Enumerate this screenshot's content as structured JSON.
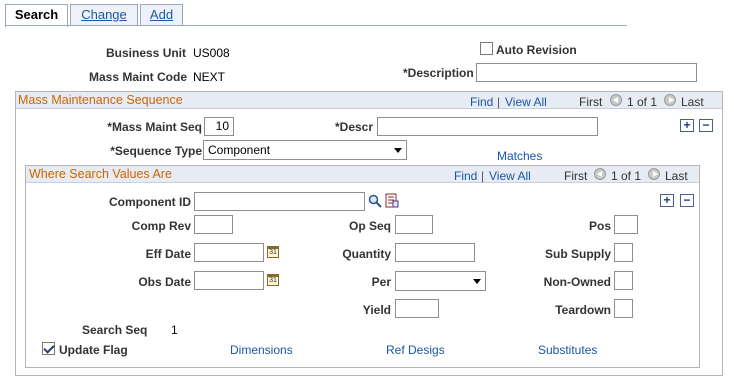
{
  "tabs": [
    {
      "label": "Search",
      "active": true
    },
    {
      "label": "Change",
      "active": false
    },
    {
      "label": "Add",
      "active": false
    }
  ],
  "header": {
    "business_unit_label": "Business Unit",
    "business_unit_value": "US008",
    "mass_maint_code_label": "Mass Maint Code",
    "mass_maint_code_value": "NEXT",
    "auto_revision_label": "Auto Revision",
    "auto_revision_checked": false,
    "description_label": "*Description",
    "description_value": ""
  },
  "sequence_box": {
    "title": "Mass Maintenance Sequence",
    "find": "Find",
    "sep": "|",
    "view_all": "View All",
    "first": "First",
    "counter": "1 of 1",
    "last": "Last",
    "seq_label": "*Mass Maint Seq",
    "seq_value": "10",
    "descr_label": "*Descr",
    "descr_value": "",
    "sequence_type_label": "*Sequence Type",
    "sequence_type_value": "Component",
    "matches_link": "Matches",
    "add_icon": "+",
    "remove_icon": "−"
  },
  "where_box": {
    "title": "Where Search Values Are",
    "find": "Find",
    "sep": "|",
    "view_all": "View All",
    "first": "First",
    "counter": "1 of 1",
    "last": "Last",
    "add_icon": "+",
    "remove_icon": "−",
    "component_id_label": "Component ID",
    "component_id_value": "",
    "comp_rev_label": "Comp Rev",
    "op_seq_label": "Op Seq",
    "pos_label": "Pos",
    "eff_date_label": "Eff Date",
    "quantity_label": "Quantity",
    "sub_supply_label": "Sub Supply",
    "obs_date_label": "Obs Date",
    "per_label": "Per",
    "per_value": "",
    "non_owned_label": "Non-Owned",
    "yield_label": "Yield",
    "teardown_label": "Teardown",
    "search_seq_label": "Search Seq",
    "search_seq_value": "1",
    "update_flag_label": "Update Flag",
    "update_flag_checked": true,
    "cal_glyph": "31"
  },
  "links": {
    "dimensions": "Dimensions",
    "ref_desigs": "Ref Desigs",
    "substitutes": "Substitutes"
  },
  "colors": {
    "link": "#1a56a8",
    "section_title": "#cc6600",
    "header_bar": "#e7ebf3"
  }
}
